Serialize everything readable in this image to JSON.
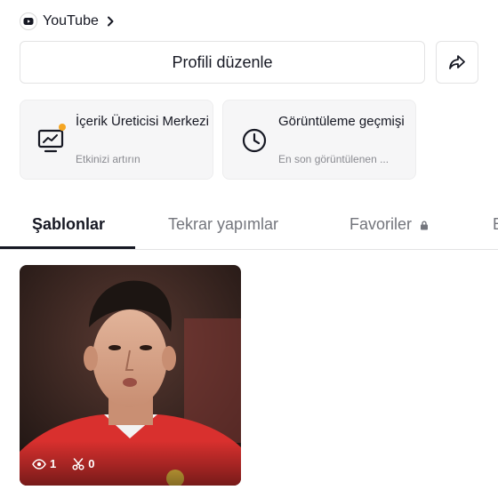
{
  "header": {
    "youtube_label": "YouTube",
    "edit_profile_label": "Profili düzenle"
  },
  "cards": [
    {
      "title": "İçerik Üreticisi Merkezi",
      "subtitle": "Etkinizi artırın",
      "icon": "creator-monitor-icon"
    },
    {
      "title": "Görüntüleme geçmişi",
      "subtitle": "En son görüntülenen ...",
      "icon": "clock-icon"
    }
  ],
  "tabs": [
    {
      "label": "Şablonlar",
      "active": true
    },
    {
      "label": "Tekrar yapımlar",
      "active": false
    },
    {
      "label": "Favoriler",
      "active": false,
      "locked": true
    },
    {
      "label": "B",
      "active": false
    }
  ],
  "templates": [
    {
      "views": "1",
      "remakes": "0"
    }
  ],
  "colors": {
    "accent_dot": "#f5a623",
    "text": "#161823",
    "muted": "#73757c"
  }
}
